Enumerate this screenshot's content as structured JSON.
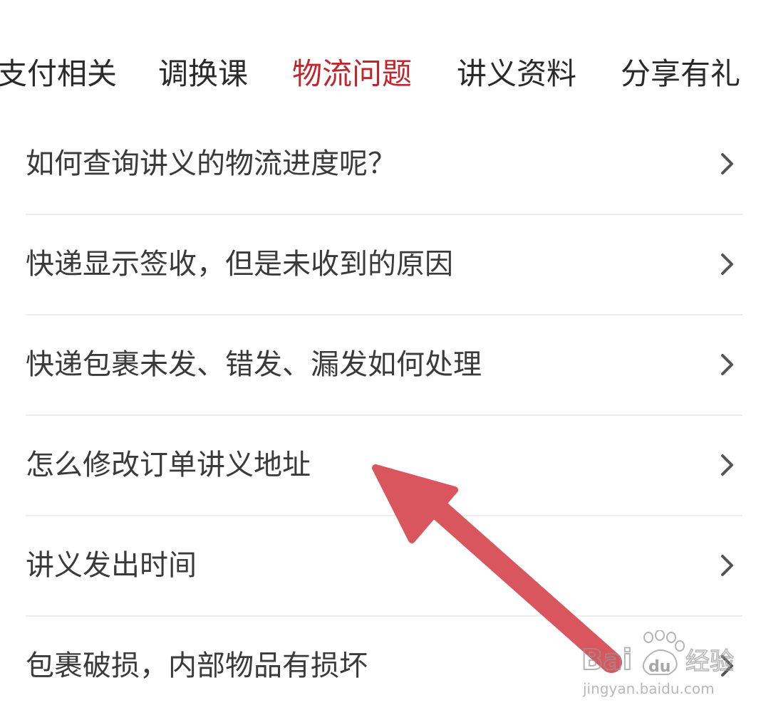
{
  "tabs": [
    {
      "label": "支付相关",
      "active": false
    },
    {
      "label": "调换课",
      "active": false
    },
    {
      "label": "物流问题",
      "active": true
    },
    {
      "label": "讲义资料",
      "active": false
    },
    {
      "label": "分享有礼",
      "active": false
    }
  ],
  "questions": [
    "如何查询讲义的物流进度呢？",
    "快递显示签收，但是未收到的原因",
    "快递包裹未发、错发、漏发如何处理",
    "怎么修改订单讲义地址",
    "讲义发出时间",
    "包裹破损，内部物品有损坏"
  ],
  "watermark": {
    "brand": "Bai du 经验",
    "url": "jingyan.baidu.com"
  },
  "colors": {
    "active_tab": "#c0262c",
    "text": "#3a3a3a",
    "arrow": "#d9565e"
  },
  "icons": {
    "row_chevron": "chevron-right-icon",
    "annotation": "arrow-annotation"
  }
}
